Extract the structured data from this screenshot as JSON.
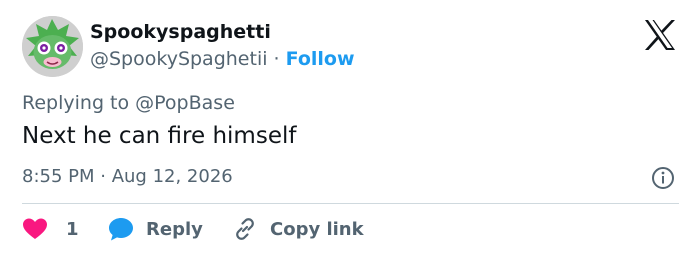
{
  "author": {
    "display_name": "Spookyspaghetti",
    "handle": "@SpookySpaghetii",
    "separator": " · ",
    "follow_label": "Follow"
  },
  "reply_context": {
    "prefix": "Replying to ",
    "handle": "@PopBase"
  },
  "tweet": {
    "text": "Next he can fire himself",
    "time": "8:55 PM",
    "separator": " · ",
    "date": "Aug 12, 2026"
  },
  "actions": {
    "like_count": "1",
    "reply_label": "Reply",
    "copy_link_label": "Copy link"
  },
  "icons": {
    "brand": "x-logo-icon",
    "info": "info-icon",
    "like": "heart-icon",
    "reply": "speech-bubble-icon",
    "copy": "link-icon"
  },
  "colors": {
    "accent": "#1d9bf0",
    "like": "#f91880",
    "secondary_text": "#536471",
    "primary_text": "#0f1419",
    "divider": "#cfd9de"
  }
}
